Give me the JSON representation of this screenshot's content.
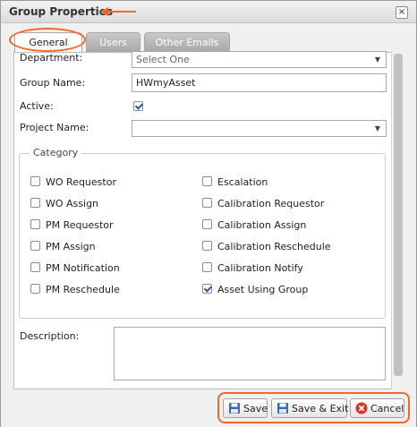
{
  "dialog": {
    "title": "Group Properties",
    "close_symbol": "×"
  },
  "tabs": [
    {
      "label": "General",
      "active": true
    },
    {
      "label": "Users",
      "active": false
    },
    {
      "label": "Other Emails",
      "active": false
    }
  ],
  "form": {
    "department_label": "Department:",
    "department_value": "Select One",
    "group_name_label": "Group Name:",
    "group_name_value": "HWmyAsset",
    "active_label": "Active:",
    "active_checked": true,
    "project_name_label": "Project Name:",
    "project_name_value": "",
    "category_legend": "Category",
    "description_label": "Description:",
    "description_value": ""
  },
  "categories": [
    {
      "label": "WO Requestor",
      "checked": false
    },
    {
      "label": "WO Assign",
      "checked": false
    },
    {
      "label": "PM Requestor",
      "checked": false
    },
    {
      "label": "PM Assign",
      "checked": false
    },
    {
      "label": "PM Notification",
      "checked": false
    },
    {
      "label": "PM Reschedule",
      "checked": false
    },
    {
      "label": "Escalation",
      "checked": false
    },
    {
      "label": "Calibration Requestor",
      "checked": false
    },
    {
      "label": "Calibration Assign",
      "checked": false
    },
    {
      "label": "Calibration Reschedule",
      "checked": false
    },
    {
      "label": "Calibration Notify",
      "checked": false
    },
    {
      "label": "Asset Using Group",
      "checked": true
    }
  ],
  "buttons": {
    "save_label": "Save",
    "save_exit_label": "Save & Exit",
    "cancel_label": "Cancel"
  },
  "icons": {
    "save": "floppy-disk-icon",
    "cancel": "cancel-circle-icon"
  },
  "colors": {
    "annotation": "#ef6a2a",
    "cancel_icon": "#d9342b",
    "save_icon": "#3a6ab0"
  }
}
